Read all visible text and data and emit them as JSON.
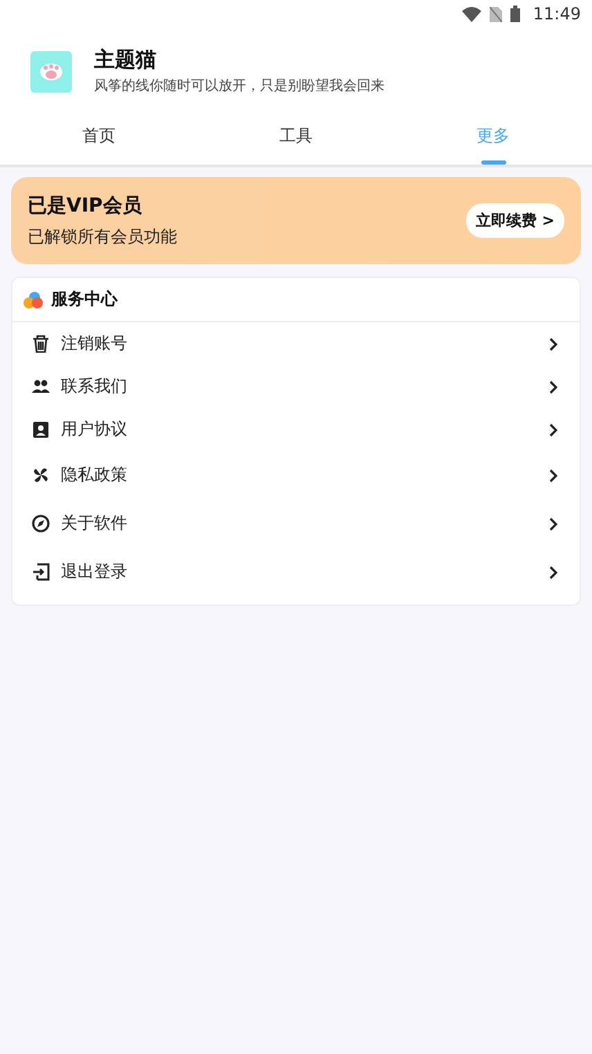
{
  "status_bar": {
    "time": "11:49"
  },
  "app": {
    "title": "主题猫",
    "subtitle": "风筝的线你随时可以放开，只是别盼望我会回来"
  },
  "tabs": [
    {
      "label": "首页",
      "selected": false
    },
    {
      "label": "工具",
      "selected": false
    },
    {
      "label": "更多",
      "selected": true
    }
  ],
  "vip_card": {
    "title": "已是VIP会员",
    "subtitle": "已解锁所有会员功能",
    "button": "立即续费 >"
  },
  "service": {
    "title": "服务中心",
    "items": [
      {
        "label": "注销账号"
      },
      {
        "label": "联系我们"
      },
      {
        "label": "用户协议"
      },
      {
        "label": "隐私政策"
      },
      {
        "label": "关于软件"
      },
      {
        "label": "退出登录"
      }
    ]
  }
}
